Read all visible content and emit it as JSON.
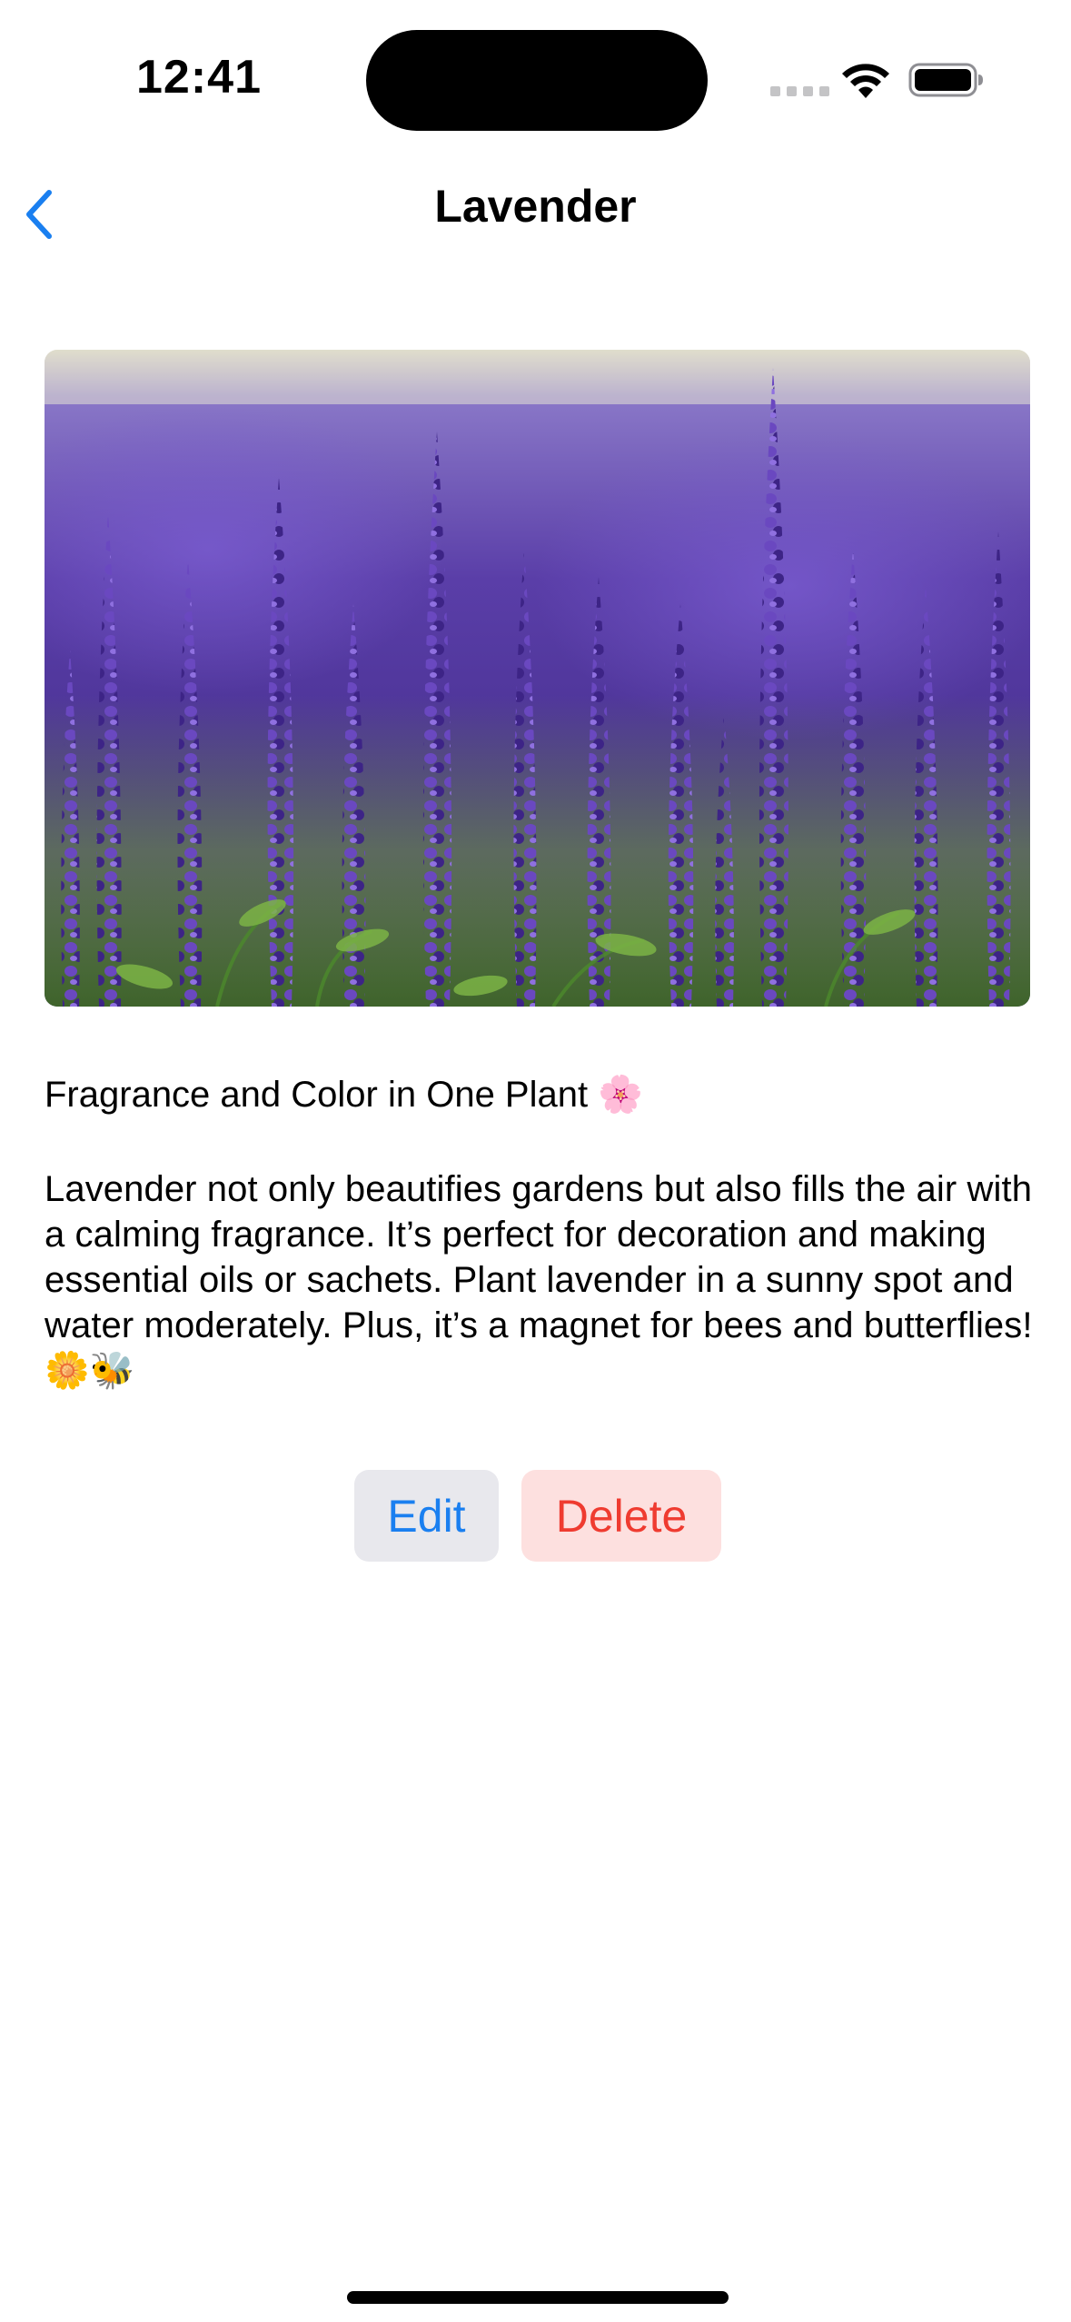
{
  "status_bar": {
    "time": "12:41"
  },
  "nav": {
    "title": "Lavender",
    "back_icon": "chevron-left-icon"
  },
  "hero": {
    "subject": "lavender-field-photo"
  },
  "content": {
    "headline": "Fragrance and Color in One Plant 🌸",
    "body": "Lavender not only beautifies gardens but also fills the air with a calming fragrance. It’s perfect for decoration and making essential oils or sachets. Plant lavender in a sunny spot and water moderately. Plus, it’s a magnet for bees and butterflies! 🌼🐝"
  },
  "actions": {
    "edit_label": "Edit",
    "delete_label": "Delete"
  },
  "colors": {
    "accent": "#1a7ff0",
    "destructive": "#ef3b30",
    "edit_bg": "#e8e8ed",
    "delete_bg": "#fde0df"
  }
}
